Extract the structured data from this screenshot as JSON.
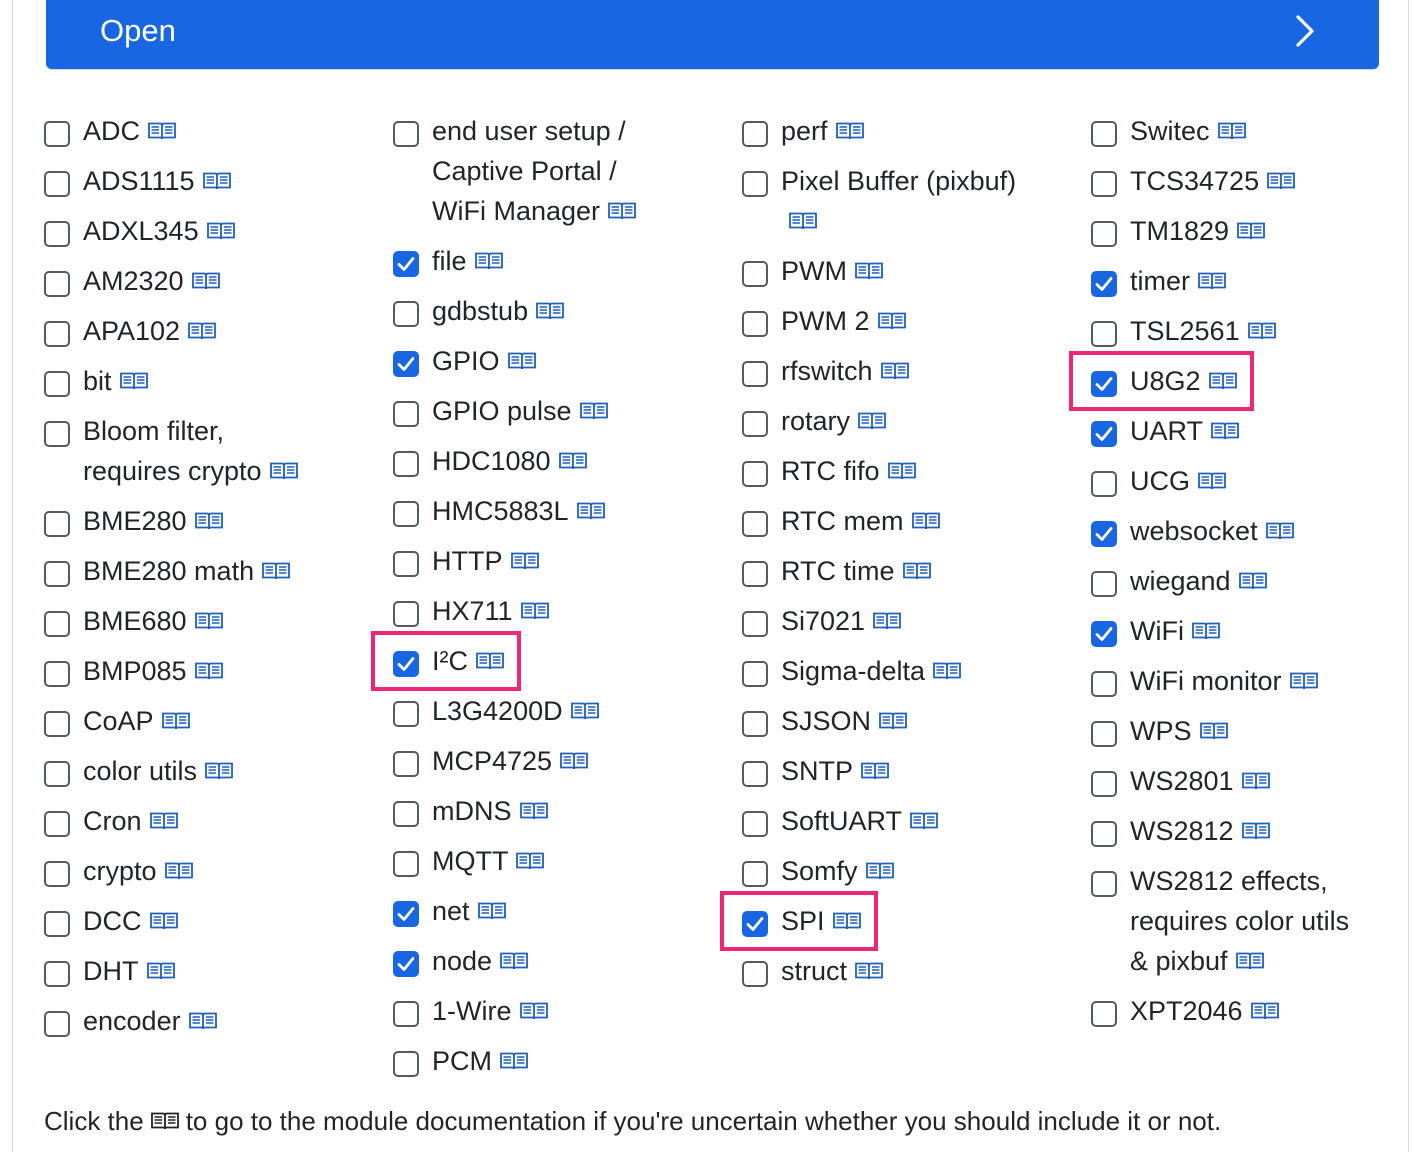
{
  "open_bar": {
    "label": "Open",
    "chevron_icon": "chevron-right-icon"
  },
  "icons": {
    "doc": "book-icon",
    "check": "checkmark-icon"
  },
  "columns": [
    [
      {
        "lines": [
          "ADC"
        ],
        "checked": false
      },
      {
        "lines": [
          "ADS1115"
        ],
        "checked": false
      },
      {
        "lines": [
          "ADXL345"
        ],
        "checked": false
      },
      {
        "lines": [
          "AM2320"
        ],
        "checked": false
      },
      {
        "lines": [
          "APA102"
        ],
        "checked": false
      },
      {
        "lines": [
          "bit"
        ],
        "checked": false
      },
      {
        "lines": [
          "Bloom filter,",
          "requires crypto"
        ],
        "checked": false
      },
      {
        "lines": [
          "BME280"
        ],
        "checked": false
      },
      {
        "lines": [
          "BME280 math"
        ],
        "checked": false
      },
      {
        "lines": [
          "BME680"
        ],
        "checked": false
      },
      {
        "lines": [
          "BMP085"
        ],
        "checked": false
      },
      {
        "lines": [
          "CoAP"
        ],
        "checked": false
      },
      {
        "lines": [
          "color utils"
        ],
        "checked": false
      },
      {
        "lines": [
          "Cron"
        ],
        "checked": false
      },
      {
        "lines": [
          "crypto"
        ],
        "checked": false
      },
      {
        "lines": [
          "DCC"
        ],
        "checked": false
      },
      {
        "lines": [
          "DHT"
        ],
        "checked": false
      },
      {
        "lines": [
          "encoder"
        ],
        "checked": false
      }
    ],
    [
      {
        "lines": [
          "end user setup /",
          "Captive Portal /",
          "WiFi Manager"
        ],
        "checked": false
      },
      {
        "lines": [
          "file"
        ],
        "checked": true
      },
      {
        "lines": [
          "gdbstub"
        ],
        "checked": false
      },
      {
        "lines": [
          "GPIO"
        ],
        "checked": true
      },
      {
        "lines": [
          "GPIO pulse"
        ],
        "checked": false
      },
      {
        "lines": [
          "HDC1080"
        ],
        "checked": false
      },
      {
        "lines": [
          "HMC5883L"
        ],
        "checked": false
      },
      {
        "lines": [
          "HTTP"
        ],
        "checked": false
      },
      {
        "lines": [
          "HX711"
        ],
        "checked": false
      },
      {
        "lines": [
          "I²C"
        ],
        "checked": true,
        "highlighted": true
      },
      {
        "lines": [
          "L3G4200D"
        ],
        "checked": false
      },
      {
        "lines": [
          "MCP4725"
        ],
        "checked": false
      },
      {
        "lines": [
          "mDNS"
        ],
        "checked": false
      },
      {
        "lines": [
          "MQTT"
        ],
        "checked": false
      },
      {
        "lines": [
          "net"
        ],
        "checked": true
      },
      {
        "lines": [
          "node"
        ],
        "checked": true
      },
      {
        "lines": [
          "1-Wire"
        ],
        "checked": false
      },
      {
        "lines": [
          "PCM"
        ],
        "checked": false
      }
    ],
    [
      {
        "lines": [
          "perf"
        ],
        "checked": false
      },
      {
        "lines": [
          "Pixel Buffer (pixbuf)",
          ""
        ],
        "checked": false
      },
      {
        "lines": [
          "PWM"
        ],
        "checked": false
      },
      {
        "lines": [
          "PWM 2"
        ],
        "checked": false
      },
      {
        "lines": [
          "rfswitch"
        ],
        "checked": false
      },
      {
        "lines": [
          "rotary"
        ],
        "checked": false
      },
      {
        "lines": [
          "RTC fifo"
        ],
        "checked": false
      },
      {
        "lines": [
          "RTC mem"
        ],
        "checked": false
      },
      {
        "lines": [
          "RTC time"
        ],
        "checked": false
      },
      {
        "lines": [
          "Si7021"
        ],
        "checked": false
      },
      {
        "lines": [
          "Sigma-delta"
        ],
        "checked": false
      },
      {
        "lines": [
          "SJSON"
        ],
        "checked": false
      },
      {
        "lines": [
          "SNTP"
        ],
        "checked": false
      },
      {
        "lines": [
          "SoftUART"
        ],
        "checked": false
      },
      {
        "lines": [
          "Somfy"
        ],
        "checked": false
      },
      {
        "lines": [
          "SPI"
        ],
        "checked": true,
        "highlighted": true
      },
      {
        "lines": [
          "struct"
        ],
        "checked": false
      }
    ],
    [
      {
        "lines": [
          "Switec"
        ],
        "checked": false
      },
      {
        "lines": [
          "TCS34725"
        ],
        "checked": false
      },
      {
        "lines": [
          "TM1829"
        ],
        "checked": false
      },
      {
        "lines": [
          "timer"
        ],
        "checked": true
      },
      {
        "lines": [
          "TSL2561"
        ],
        "checked": false
      },
      {
        "lines": [
          "U8G2"
        ],
        "checked": true,
        "highlighted": true
      },
      {
        "lines": [
          "UART"
        ],
        "checked": true
      },
      {
        "lines": [
          "UCG"
        ],
        "checked": false
      },
      {
        "lines": [
          "websocket"
        ],
        "checked": true
      },
      {
        "lines": [
          "wiegand"
        ],
        "checked": false
      },
      {
        "lines": [
          "WiFi"
        ],
        "checked": true
      },
      {
        "lines": [
          "WiFi monitor"
        ],
        "checked": false
      },
      {
        "lines": [
          "WPS"
        ],
        "checked": false
      },
      {
        "lines": [
          "WS2801"
        ],
        "checked": false
      },
      {
        "lines": [
          "WS2812"
        ],
        "checked": false
      },
      {
        "lines": [
          "WS2812 effects,",
          "requires color utils",
          "& pixbuf"
        ],
        "checked": false
      },
      {
        "lines": [
          "XPT2046"
        ],
        "checked": false
      }
    ]
  ],
  "footer": {
    "before": "Click the",
    "after": "to go to the module documentation if you're uncertain whether you should include it or not."
  },
  "colors": {
    "accent": "#1966e3",
    "highlight": "#ec2778",
    "doc_icon": "#1f5fbf"
  }
}
